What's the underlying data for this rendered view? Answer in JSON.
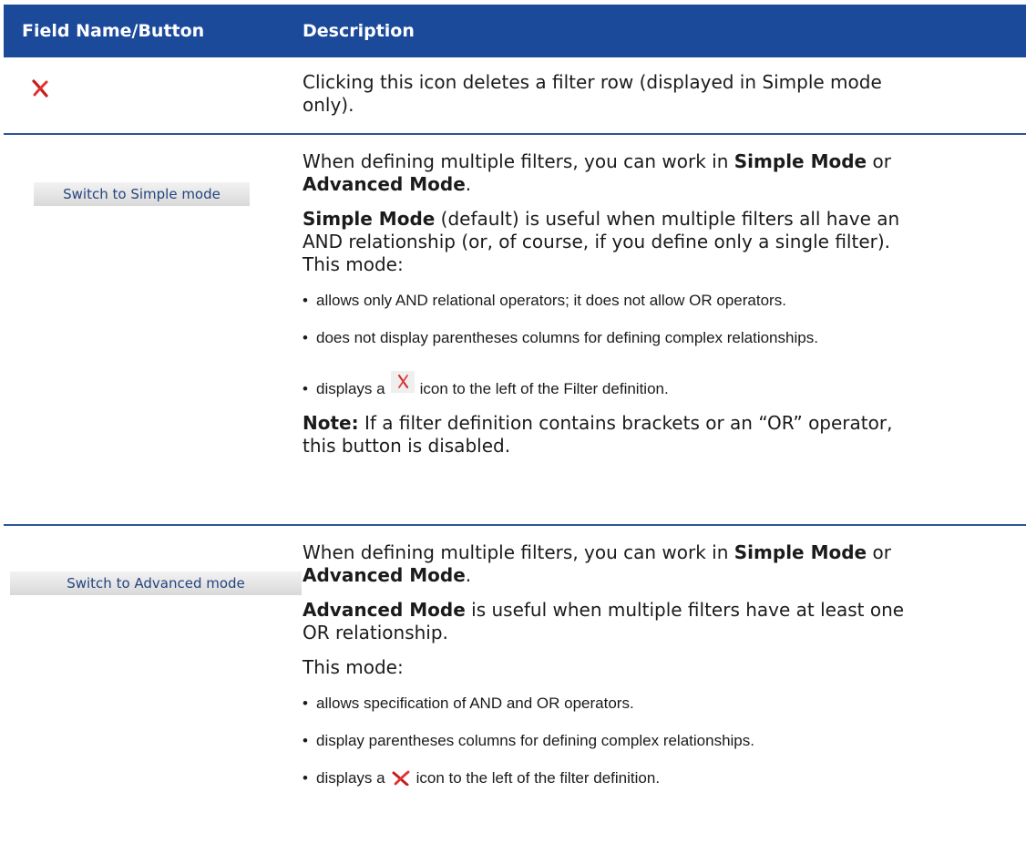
{
  "header": {
    "col1_label": "Field Name/Button",
    "col2_label": "Description"
  },
  "row_delete": {
    "icon": "delete-x-icon",
    "desc_line1": "Clicking this icon deletes a filter row (displayed in Simple mode",
    "desc_line2": "only)."
  },
  "row_simple": {
    "button_label": "Switch to Simple mode",
    "intro": {
      "line1_pre": "When defining multiple filters, you can work in ",
      "line1_bold": "Simple Mode",
      "line1_post": " or",
      "line2_bold": "Advanced Mode",
      "line2_post": "."
    },
    "para2": {
      "bold": "Simple Mode",
      "line1_post": " (default) is useful when multiple filters all have an",
      "line2": "AND relationship (or, of course, if you define only a single filter).",
      "line3": "This mode:"
    },
    "bullets": [
      "allows only AND relational operators; it does not allow OR operators.",
      "does not display parentheses columns for defining complex relationships."
    ],
    "bullet3_pre": "displays a",
    "bullet3_post": "icon to the left of the Filter definition.",
    "bullet3_icon": "delete-x-icon",
    "note": {
      "bold": "Note:",
      "line1_post": " If a filter definition contains brackets or an “OR” operator,",
      "line2": "this button is disabled."
    }
  },
  "row_advanced": {
    "button_label": "Switch to Advanced mode",
    "intro": {
      "line1_pre": "When defining multiple filters, you can work in ",
      "line1_bold": "Simple Mode",
      "line1_post": " or",
      "line2_bold": "Advanced Mode",
      "line2_post": "."
    },
    "para2": {
      "bold": "Advanced Mode",
      "line1_post": " is useful when multiple filters have at least one",
      "line2": "OR relationship."
    },
    "para3": "This mode:",
    "bullets": [
      "allows specification of AND and OR operators.",
      "display parentheses columns for defining complex relationships."
    ],
    "bullet3_pre": "displays a",
    "bullet3_post": "icon to the left of the filter definition.",
    "bullet3_icon": "delete-x-icon"
  },
  "colors": {
    "header_bg": "#1c4a9b",
    "header_text": "#ffffff",
    "divider": "#2d5594",
    "icon_red": "#d42020",
    "button_text": "#24447f"
  }
}
